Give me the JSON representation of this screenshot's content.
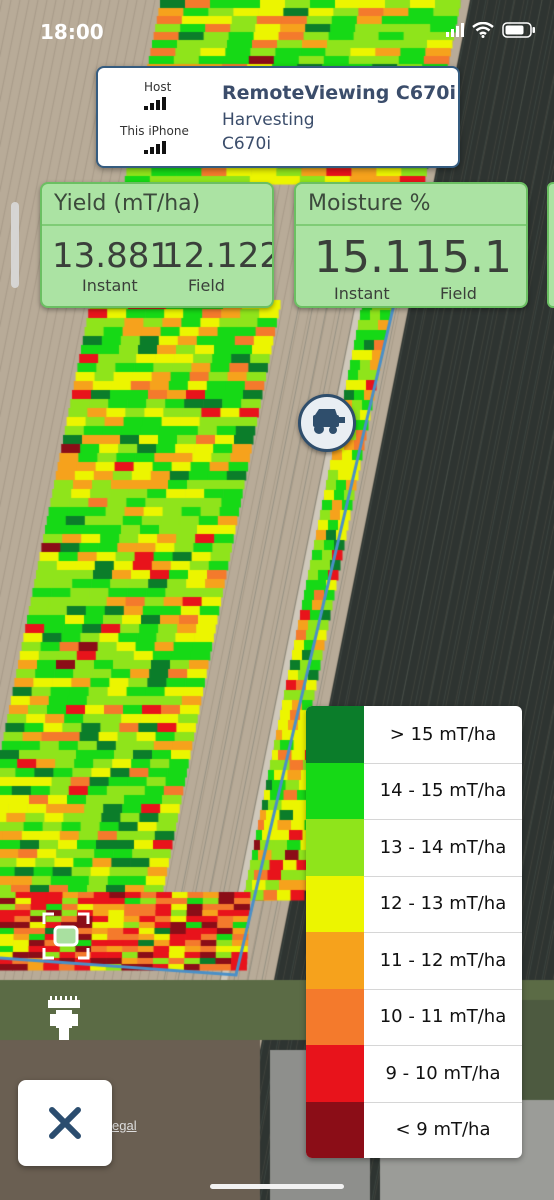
{
  "status_bar": {
    "time": "18:00"
  },
  "connection": {
    "host_label": "Host",
    "device_label": "This iPhone",
    "title": "RemoteViewing C670i",
    "state": "Harvesting",
    "machine": "C670i"
  },
  "yield_card": {
    "title": "Yield (mT/ha)",
    "instant_value": "13.881",
    "instant_label": "Instant",
    "field_value": "12.122",
    "field_label": "Field"
  },
  "moisture_card": {
    "title": "Moisture %",
    "instant_value": "15.1",
    "instant_label": "Instant",
    "field_value": "15.1",
    "field_label": "Field"
  },
  "legend": {
    "items": [
      {
        "label": "> 15 mT/ha",
        "color": "#0b7d2a"
      },
      {
        "label": "14 - 15 mT/ha",
        "color": "#16d916"
      },
      {
        "label": "13 - 14 mT/ha",
        "color": "#8fe41b"
      },
      {
        "label": "12 - 13 mT/ha",
        "color": "#ecf500"
      },
      {
        "label": "11 - 12 mT/ha",
        "color": "#f6a21c"
      },
      {
        "label": "10 - 11 mT/ha",
        "color": "#f47a2c"
      },
      {
        "label": "9 - 10 mT/ha",
        "color": "#e8131b"
      },
      {
        "label": "< 9 mT/ha",
        "color": "#8b0d17"
      }
    ]
  },
  "map": {
    "legal_label": "egal"
  },
  "close_button": {
    "icon": "close-icon",
    "color": "#2b4d6f"
  }
}
